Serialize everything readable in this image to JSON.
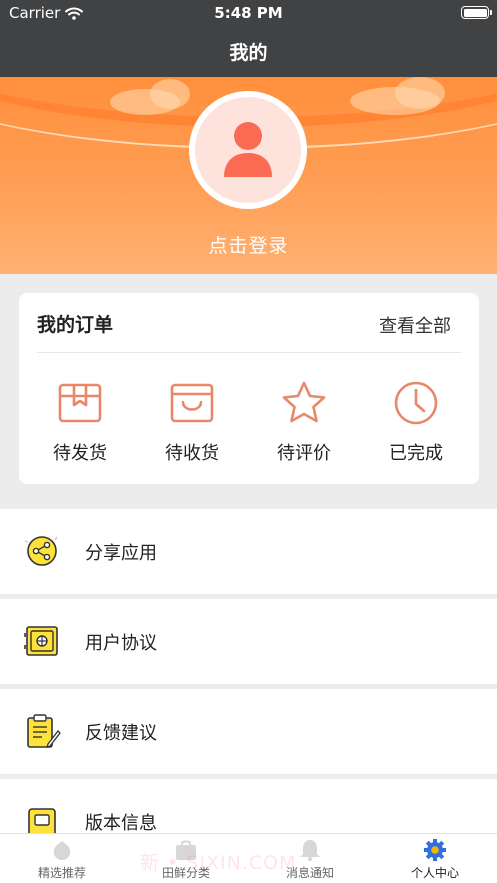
{
  "status_bar": {
    "carrier": "Carrier",
    "time": "5:48 PM"
  },
  "nav": {
    "title": "我的"
  },
  "profile": {
    "login_text": "点击登录"
  },
  "orders": {
    "title": "我的订单",
    "view_all": "查看全部",
    "items": [
      {
        "label": "待发货",
        "icon": "package-icon"
      },
      {
        "label": "待收货",
        "icon": "shopping-bag-icon"
      },
      {
        "label": "待评价",
        "icon": "star-icon"
      },
      {
        "label": "已完成",
        "icon": "clock-icon"
      }
    ]
  },
  "menu": [
    {
      "label": "分享应用",
      "icon": "share-icon"
    },
    {
      "label": "用户协议",
      "icon": "safe-icon"
    },
    {
      "label": "反馈建议",
      "icon": "clipboard-icon"
    },
    {
      "label": "版本信息",
      "icon": "version-icon"
    }
  ],
  "tabs": [
    {
      "label": "精选推荐",
      "icon": "recommend-icon",
      "active": false
    },
    {
      "label": "田鲜分类",
      "icon": "category-icon",
      "active": false
    },
    {
      "label": "消息通知",
      "icon": "bell-icon",
      "active": false
    },
    {
      "label": "个人中心",
      "icon": "gear-icon",
      "active": true
    }
  ],
  "watermark": "新 • SIXIN.COM",
  "colors": {
    "accent": "#ff8f3c",
    "icon_stroke": "#e9876b",
    "menu_icon_yellow": "#fde23b",
    "nav_bg": "#404244",
    "active_tab": "#2f6fe0"
  }
}
